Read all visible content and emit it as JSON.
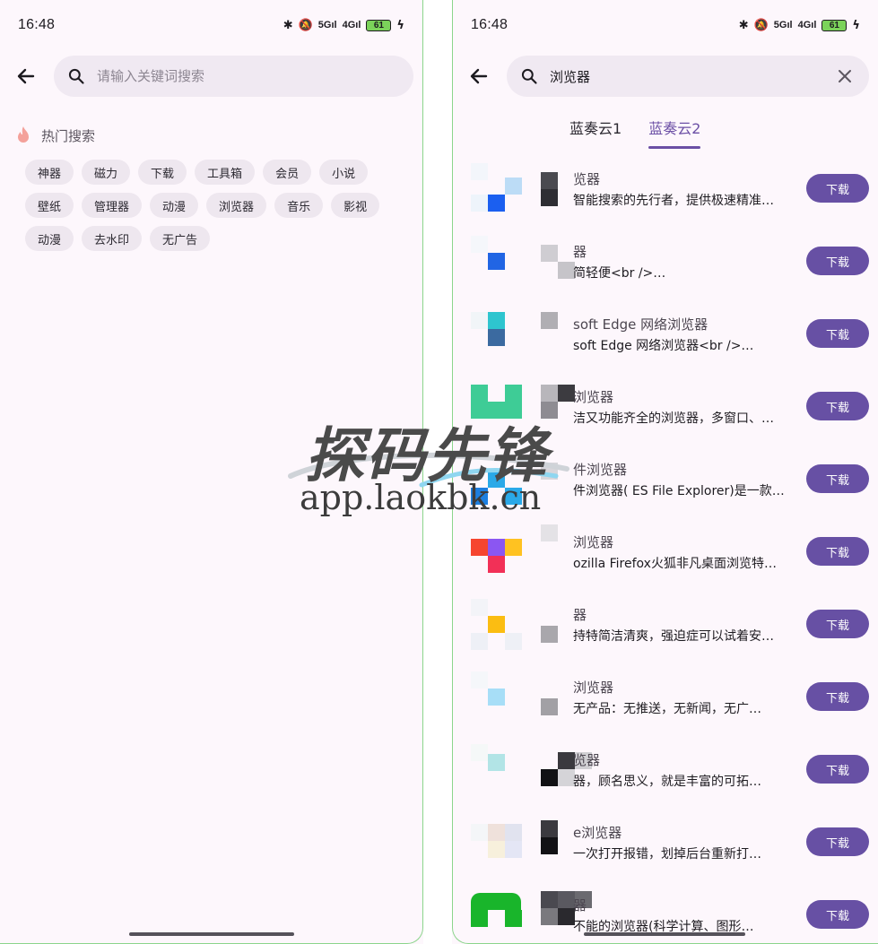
{
  "status": {
    "time": "16:48",
    "network_1": "5G",
    "network_2": "4G",
    "battery": "61"
  },
  "left": {
    "search_placeholder": "请输入关键词搜索",
    "hot_title": "热门搜索",
    "chips": [
      "神器",
      "磁力",
      "下载",
      "工具箱",
      "会员",
      "小说",
      "壁纸",
      "管理器",
      "动漫",
      "浏览器",
      "音乐",
      "影视",
      "动漫",
      "去水印",
      "无广告"
    ]
  },
  "right": {
    "search_value": "浏览器",
    "tabs": [
      {
        "label": "蓝奏云1",
        "active": false
      },
      {
        "label": "蓝奏云2",
        "active": true
      }
    ],
    "download_label": "下载",
    "results": [
      {
        "title": "览器",
        "desc": "智能搜索的先行者，提供极速精准…"
      },
      {
        "title": "器",
        "desc": "简轻便<br />…"
      },
      {
        "title": "soft Edge 网络浏览器",
        "desc": "soft Edge 网络浏览器<br />…"
      },
      {
        "title": "浏览器",
        "desc": "洁又功能齐全的浏览器，多窗口、…"
      },
      {
        "title": "件浏览器",
        "desc": "件浏览器( ES File Explorer)是一款…"
      },
      {
        "title": "浏览器",
        "desc": "ozilla Firefox火狐非凡桌面浏览特…"
      },
      {
        "title": "器",
        "desc": "持特简洁清爽，强迫症可以试着安…"
      },
      {
        "title": "浏览器",
        "desc": "无产品：无推送，无新闻，无广…"
      },
      {
        "title": "览器",
        "desc": "器，顾名思义，就是丰富的可拓…"
      },
      {
        "title": "e浏览器",
        "desc": "一次打开报错，划掉后台重新打…"
      },
      {
        "title": "器",
        "desc": "不能的浏览器(科学计算、图形…"
      }
    ]
  },
  "watermark": {
    "brand": "探码先锋",
    "url": "app.laokbk.cn"
  }
}
